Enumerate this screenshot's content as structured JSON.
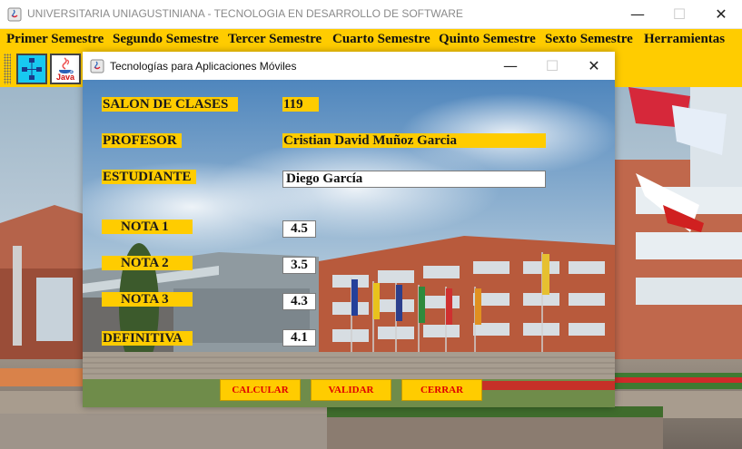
{
  "outer_window": {
    "title": "UNIVERSITARIA UNIAGUSTINIANA - TECNOLOGIA EN DESARROLLO DE SOFTWARE",
    "controls": {
      "minimize": "—",
      "maximize": "☐",
      "close": "✕"
    }
  },
  "menubar": {
    "items": [
      "Primer Semestre",
      "Segundo Semestre",
      "Tercer Semestre",
      "Cuarto Semestre",
      "Quinto Semestre",
      "Sexto Semestre",
      "Herramientas"
    ]
  },
  "toolbar": {
    "java_label": "Java"
  },
  "inner_window": {
    "title": "Tecnologías para Aplicaciones Móviles",
    "controls": {
      "minimize": "—",
      "maximize": "☐",
      "close": "✕"
    }
  },
  "form": {
    "salon_label": "SALON DE CLASES",
    "salon_value": "119",
    "profesor_label": "PROFESOR",
    "profesor_value": "Cristian David Muñoz Garcia",
    "estudiante_label": "ESTUDIANTE",
    "estudiante_value": "Diego García",
    "nota1_label": "NOTA 1",
    "nota1_value": "4.5",
    "nota2_label": "NOTA 2",
    "nota2_value": "3.5",
    "nota3_label": "NOTA 3",
    "nota3_value": "4.3",
    "definitiva_label": "DEFINITIVA",
    "definitiva_value": "4.1"
  },
  "buttons": {
    "calcular": "CALCULAR",
    "validar": "VALIDAR",
    "cerrar": "CERRAR"
  },
  "colors": {
    "accent_yellow": "#ffcc00",
    "button_text_red": "#e00000"
  }
}
